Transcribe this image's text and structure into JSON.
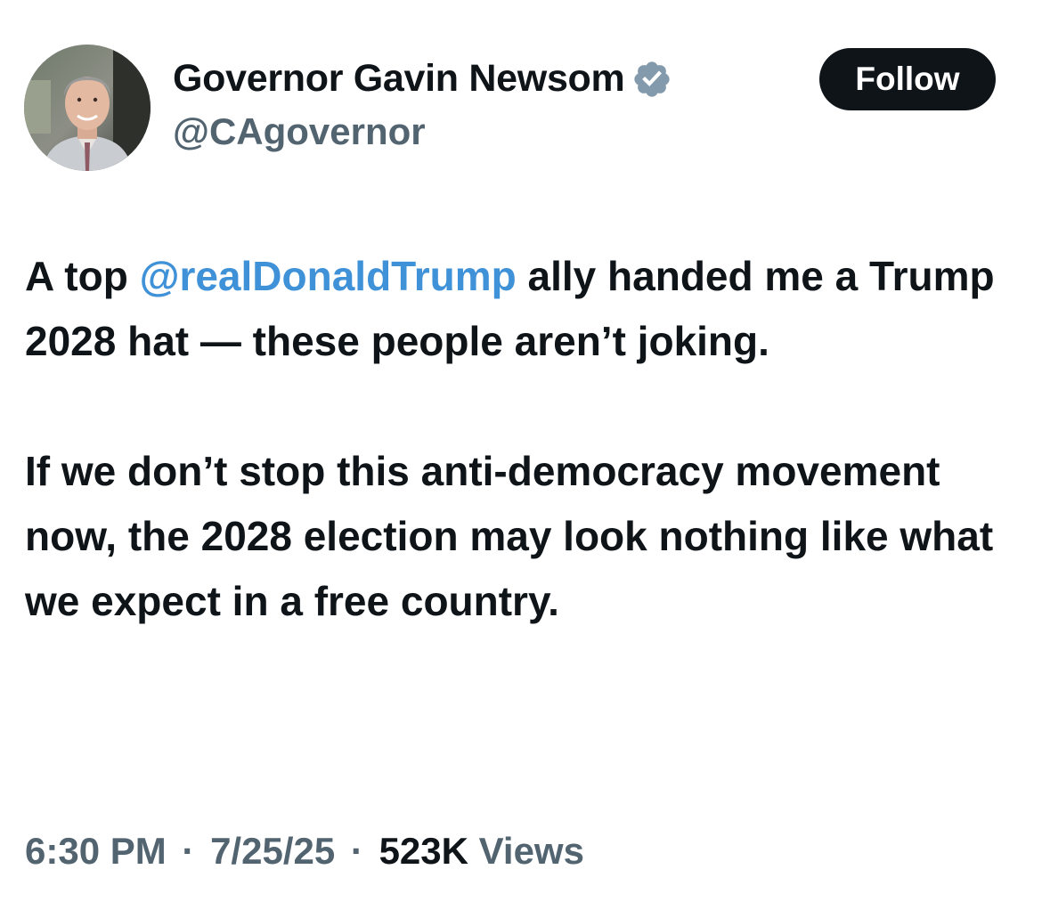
{
  "author": {
    "display_name": "Governor Gavin Newsom",
    "handle": "@CAgovernor",
    "verified_icon": "verified-badge-icon",
    "verified_color": "#829aab"
  },
  "follow_button": {
    "label": "Follow",
    "background": "#0f1419",
    "text_color": "#ffffff"
  },
  "tweet": {
    "paragraph1": {
      "before": "A top ",
      "mention": "@realDonaldTrump",
      "after": " ally handed me a Trump 2028 hat — these people aren’t joking."
    },
    "paragraph2": "If we don’t stop this anti-democracy movement now, the 2028 election may look nothing like what we expect in a free country.",
    "mention_color": "#3f91d8"
  },
  "meta": {
    "time": "6:30 PM",
    "separator": "·",
    "date": "7/25/25",
    "views_count": "523K",
    "views_label": "Views"
  }
}
